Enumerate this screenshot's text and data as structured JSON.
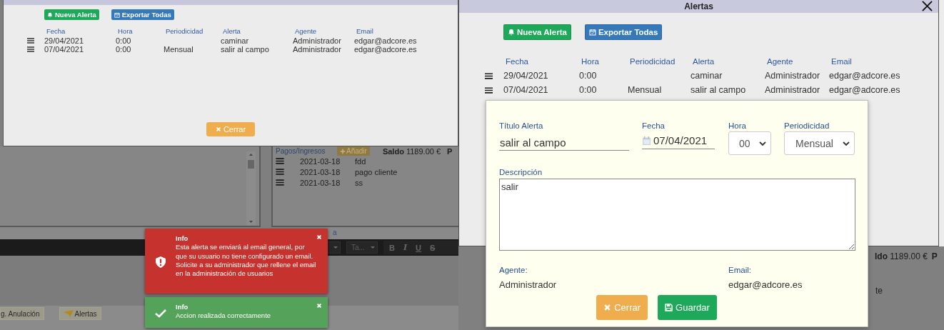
{
  "left_screen": {
    "modal": {
      "buttons": [
        {
          "label": "Nueva Alerta",
          "kind": "new"
        },
        {
          "label": "Exportar Todas",
          "kind": "export"
        }
      ],
      "columns": [
        "Fecha",
        "Hora",
        "Periodicidad",
        "Alerta",
        "Agente",
        "Email"
      ],
      "rows": [
        {
          "fecha": "29/04/2021",
          "hora": "0:00",
          "alerta": "caminar",
          "agente": "Administrador",
          "email": "edgar@adcore.es"
        },
        {
          "fecha": "07/04/2021",
          "hora": "0:00",
          "periodicidad": "Mensual",
          "alerta": "salir al campo",
          "agente": "Administrador",
          "email": "edgar@adcore.es"
        }
      ],
      "close_button": "Cerrar"
    },
    "background": {
      "payments_header": "Pagos/Ingresos",
      "add_button": "Añadir",
      "balance_label": "Saldo",
      "balance": "1189.00 €",
      "cut_label": "P",
      "payments": [
        {
          "date": "2021-03-18",
          "concept": "fdd"
        },
        {
          "date": "2021-03-18",
          "concept": "pago cliente"
        },
        {
          "date": "2021-03-18",
          "concept": "ss"
        }
      ],
      "link_fragment": "a",
      "font_size_select": "Ta...",
      "format_buttons": [
        "B",
        "I",
        "U",
        "S"
      ],
      "bottom_buttons": [
        {
          "label": "g. Anulación",
          "kind": "plain"
        },
        {
          "label": "Alertas",
          "kind": "alerts"
        }
      ]
    },
    "toasts": [
      {
        "kind": "error",
        "title": "Info",
        "message": "Esta alerta se enviará al email general, por que su usuario no tiene configurado un email. Solicite a su administrador que rellene el email en la administración de usuarios"
      },
      {
        "kind": "success",
        "title": "Info",
        "message": "Accion realizada correctamente"
      }
    ]
  },
  "right_screen": {
    "modal": {
      "title": "Alertas",
      "buttons": [
        {
          "label": "Nueva Alerta",
          "kind": "new"
        },
        {
          "label": "Exportar Todas",
          "kind": "export"
        }
      ],
      "columns": [
        "Fecha",
        "Hora",
        "Periodicidad",
        "Alerta",
        "Agente",
        "Email"
      ],
      "rows": [
        {
          "fecha": "29/04/2021",
          "hora": "0:00",
          "alerta": "caminar",
          "agente": "Administrador",
          "email": "edgar@adcore.es"
        },
        {
          "fecha": "07/04/2021",
          "hora": "0:00",
          "periodicidad": "Mensual",
          "alerta": "salir al campo",
          "agente": "Administrador",
          "email": "edgar@adcore.es"
        }
      ]
    },
    "background": {
      "balance_fragment": "ldo",
      "balance": "1189.00 €",
      "cut_label": "P",
      "text_fragment": "te"
    },
    "editor": {
      "title_label": "Título Alerta",
      "title_value": "salir al campo",
      "date_label": "Fecha",
      "date_value": "07/04/2021",
      "hour_label": "Hora",
      "hour_value": "00",
      "period_label": "Periodicidad",
      "period_value": "Mensual",
      "description_label": "Descripción",
      "description_value": "salir",
      "agent_label": "Agente:",
      "agent_value": "Administrador",
      "email_label": "Email:",
      "email_value": "edgar@adcore.es",
      "buttons": [
        {
          "label": "Cerrar",
          "kind": "close"
        },
        {
          "label": "Guardar",
          "kind": "save"
        }
      ]
    }
  }
}
